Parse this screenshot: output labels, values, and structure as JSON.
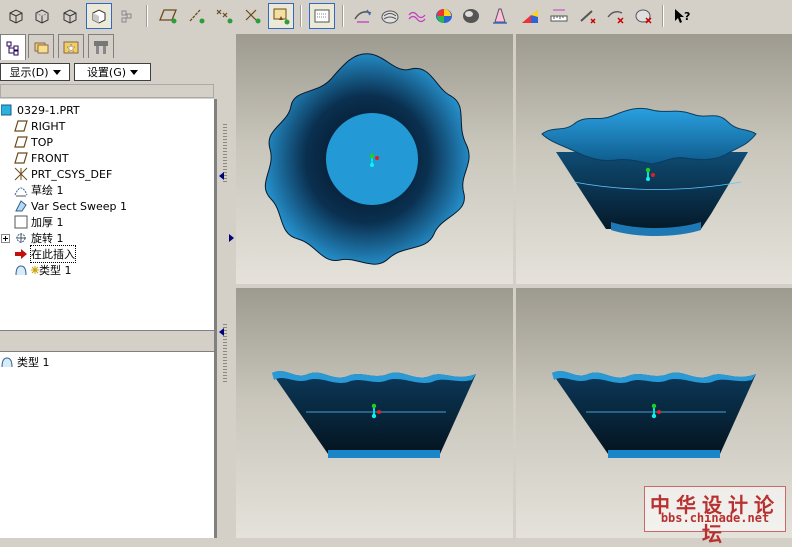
{
  "toolbar": {
    "buttons": [
      {
        "name": "view-no-hidden-icon"
      },
      {
        "name": "view-hidden-line-icon"
      },
      {
        "name": "view-wireframe-icon"
      },
      {
        "name": "view-shaded-icon"
      },
      {
        "name": "view-options-icon"
      },
      {
        "name": "datum-plane-display-icon"
      },
      {
        "name": "datum-axis-display-icon"
      },
      {
        "name": "point-display-icon"
      },
      {
        "name": "csys-display-icon"
      },
      {
        "name": "annotation-display-icon"
      },
      {
        "name": "layer-view-icon"
      },
      {
        "name": "surface-analysis-icon"
      },
      {
        "name": "reflection-analysis-icon"
      },
      {
        "name": "curvature-icon"
      },
      {
        "name": "color-map-icon"
      },
      {
        "name": "shade-analysis-icon"
      },
      {
        "name": "draft-analysis-icon"
      },
      {
        "name": "slope-analysis-icon"
      },
      {
        "name": "measure-icon"
      },
      {
        "name": "delete-analysis-icon"
      },
      {
        "name": "hide-analysis-icon"
      },
      {
        "name": "remove-display-icon"
      },
      {
        "name": "whats-this-help-icon"
      }
    ]
  },
  "left_panel": {
    "tabs": [
      {
        "name": "model-tree-tab",
        "active": true
      },
      {
        "name": "folder-browser-tab",
        "active": false
      },
      {
        "name": "favorites-tab",
        "active": false
      },
      {
        "name": "connections-tab",
        "active": false
      }
    ],
    "menu": {
      "display_label": "显示(D)",
      "settings_label": "设置(G)"
    },
    "tree": [
      {
        "label": "0329-1.PRT",
        "icon": "part-icon",
        "indent": 0
      },
      {
        "label": "RIGHT",
        "icon": "datum-plane-icon",
        "indent": 1
      },
      {
        "label": "TOP",
        "icon": "datum-plane-icon",
        "indent": 1
      },
      {
        "label": "FRONT",
        "icon": "datum-plane-icon",
        "indent": 1
      },
      {
        "label": "PRT_CSYS_DEF",
        "icon": "csys-icon",
        "indent": 1
      },
      {
        "label": "草绘 1",
        "icon": "sketch-icon",
        "indent": 1
      },
      {
        "label": "Var Sect Sweep 1",
        "icon": "sweep-icon",
        "indent": 1
      },
      {
        "label": "加厚 1",
        "icon": "thicken-icon",
        "indent": 1
      },
      {
        "label": "旋转 1",
        "icon": "revolve-icon",
        "indent": 1,
        "expandable": true
      },
      {
        "label": "在此插入",
        "icon": "insert-here-icon",
        "indent": 1,
        "selected": true
      },
      {
        "label": "类型 1",
        "icon": "pattern-icon",
        "indent": 1
      }
    ],
    "sub_tree": [
      {
        "label": "类型 1",
        "icon": "pattern-icon"
      }
    ]
  },
  "watermark": {
    "cn": "中华设计论坛",
    "url": "bbs.chinade.net"
  },
  "colors": {
    "model_light": "#2aa0e0",
    "model_dark": "#0a2438",
    "model_mid": "#0f5c8e"
  }
}
